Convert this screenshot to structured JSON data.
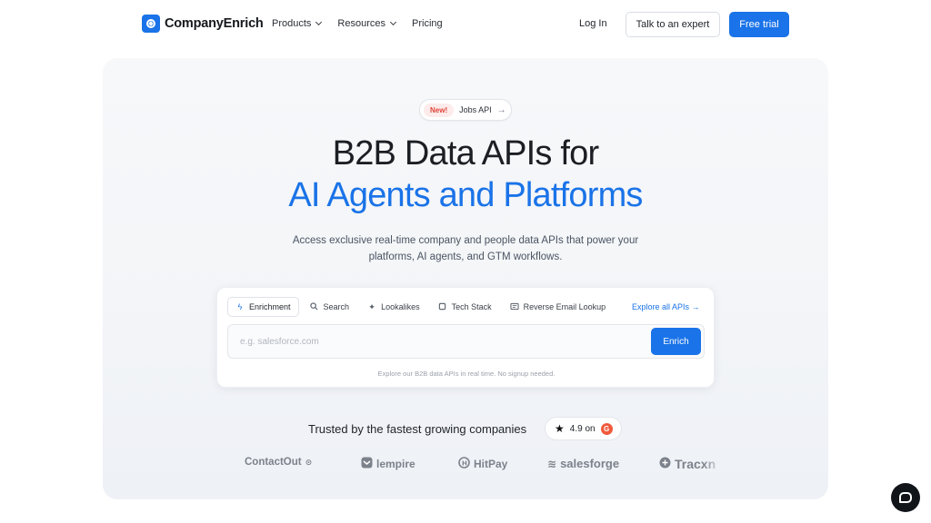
{
  "nav": {
    "brand": "CompanyEnrich",
    "links": [
      {
        "label": "Products",
        "has_dropdown": true
      },
      {
        "label": "Resources",
        "has_dropdown": true
      },
      {
        "label": "Pricing",
        "has_dropdown": false
      }
    ],
    "login": "Log In",
    "expert": "Talk to an expert",
    "trial": "Free trial"
  },
  "hero": {
    "badge": "New!",
    "badge_link": "Jobs API",
    "title_line1": "B2B Data APIs for",
    "title_line2": "AI Agents and Platforms",
    "subtitle_line1": "Access exclusive real-time company and people data APIs that power your",
    "subtitle_line2": "platforms, AI agents, and GTM workflows."
  },
  "search_card": {
    "tabs": [
      {
        "label": "Enrichment",
        "icon": "lightning-icon",
        "active": true
      },
      {
        "label": "Search",
        "icon": "search-icon",
        "active": false
      },
      {
        "label": "Lookalikes",
        "icon": "sparkle-icon",
        "active": false
      },
      {
        "label": "Tech Stack",
        "icon": "chip-icon",
        "active": false
      },
      {
        "label": "Reverse Email Lookup",
        "icon": "card-icon",
        "active": false
      }
    ],
    "explore_link": "Explore all APIs →",
    "input_value": "",
    "input_placeholder": "e.g. salesforce.com",
    "submit_label": "Enrich",
    "note": "Explore our B2B data APIs in real time. No signup needed."
  },
  "social_proof": {
    "trusted_text": "Trusted by the fastest growing companies",
    "rating": "4.9 on",
    "rating_source": "G",
    "logos": [
      "ContactOut",
      "lempire",
      "HitPay",
      "salesforge",
      "Tracxn"
    ]
  },
  "colors": {
    "accent": "#1a73e8",
    "badge_red": "#e0453a",
    "text_dark": "#1b1e23"
  }
}
